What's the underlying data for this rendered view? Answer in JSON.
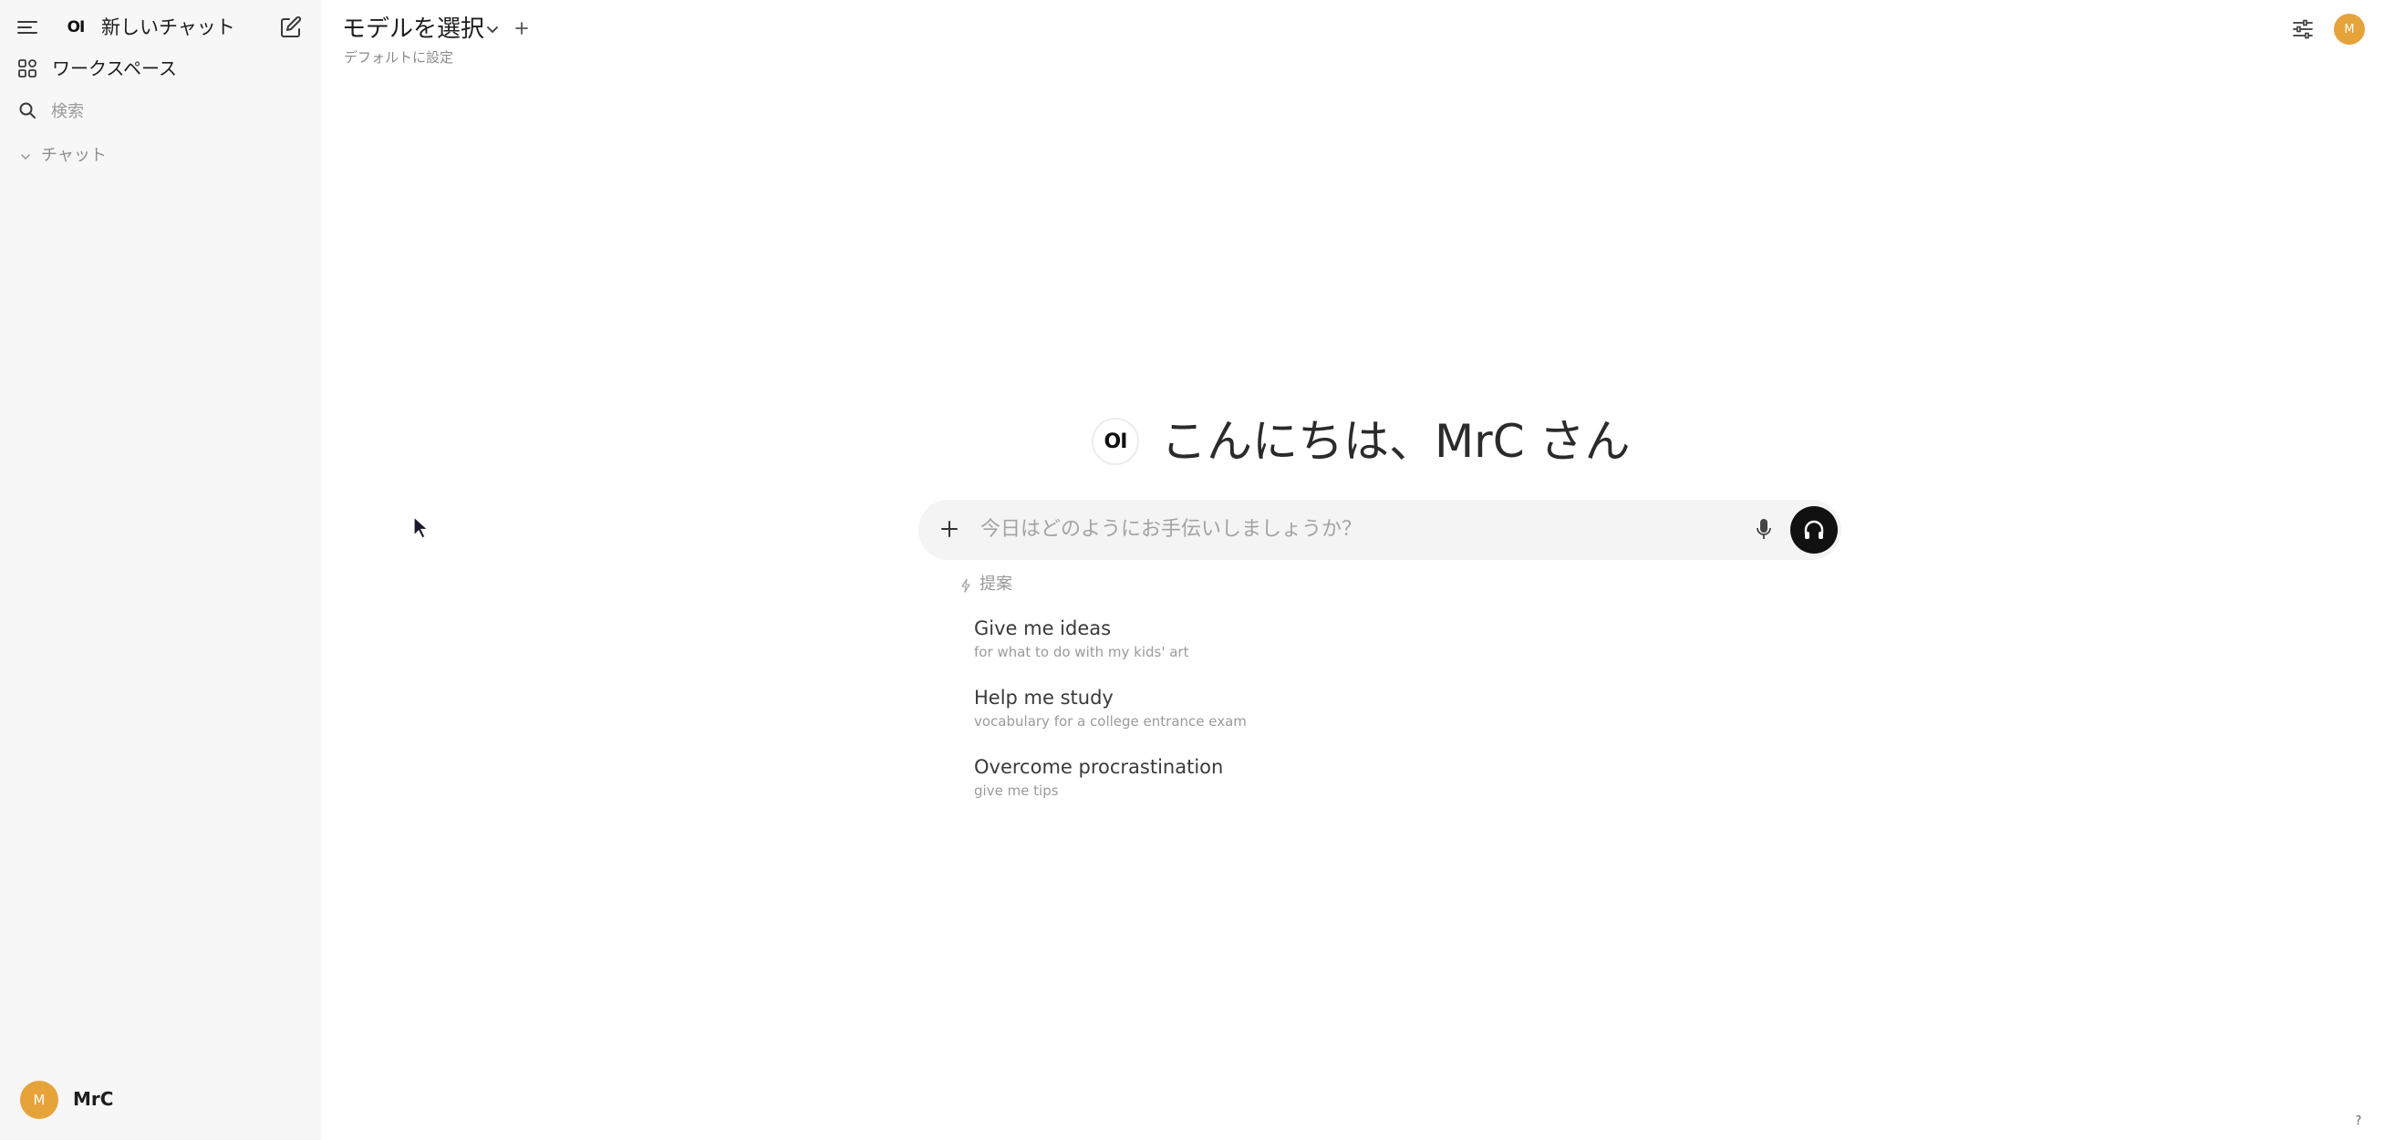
{
  "sidebar": {
    "logo_text": "OI",
    "new_chat_label": "新しいチャット",
    "workspace_label": "ワークスペース",
    "search_placeholder": "検索",
    "chats_section_label": "チャット",
    "user": {
      "avatar_initial": "M",
      "name": "MrC"
    }
  },
  "header": {
    "model_select_label": "モデルを選択",
    "set_default_label": "デフォルトに設定",
    "avatar_initial": "M"
  },
  "main": {
    "greeting_logo_text": "OI",
    "greeting": "こんにちは、MrC さん",
    "input": {
      "placeholder": "今日はどのようにお手伝いしましょうか？",
      "value": ""
    },
    "suggestions_label": "提案",
    "suggestions": [
      {
        "title": "Give me ideas",
        "subtitle": "for what to do with my kids' art"
      },
      {
        "title": "Help me study",
        "subtitle": "vocabulary for a college entrance exam"
      },
      {
        "title": "Overcome procrastination",
        "subtitle": "give me tips"
      }
    ]
  },
  "footer": {
    "help_label": "?"
  },
  "colors": {
    "sidebar_bg": "#f7f7f7",
    "avatar": "#e6a33a",
    "input_bg": "#f4f4f4",
    "voice_button": "#111111"
  },
  "icons": [
    "menu-icon",
    "edit-icon",
    "workspace-icon",
    "search-icon",
    "chevron-down-icon",
    "plus-icon",
    "settings-sliders-icon",
    "mic-icon",
    "headphones-icon",
    "sparkle-icon",
    "cursor-icon"
  ]
}
